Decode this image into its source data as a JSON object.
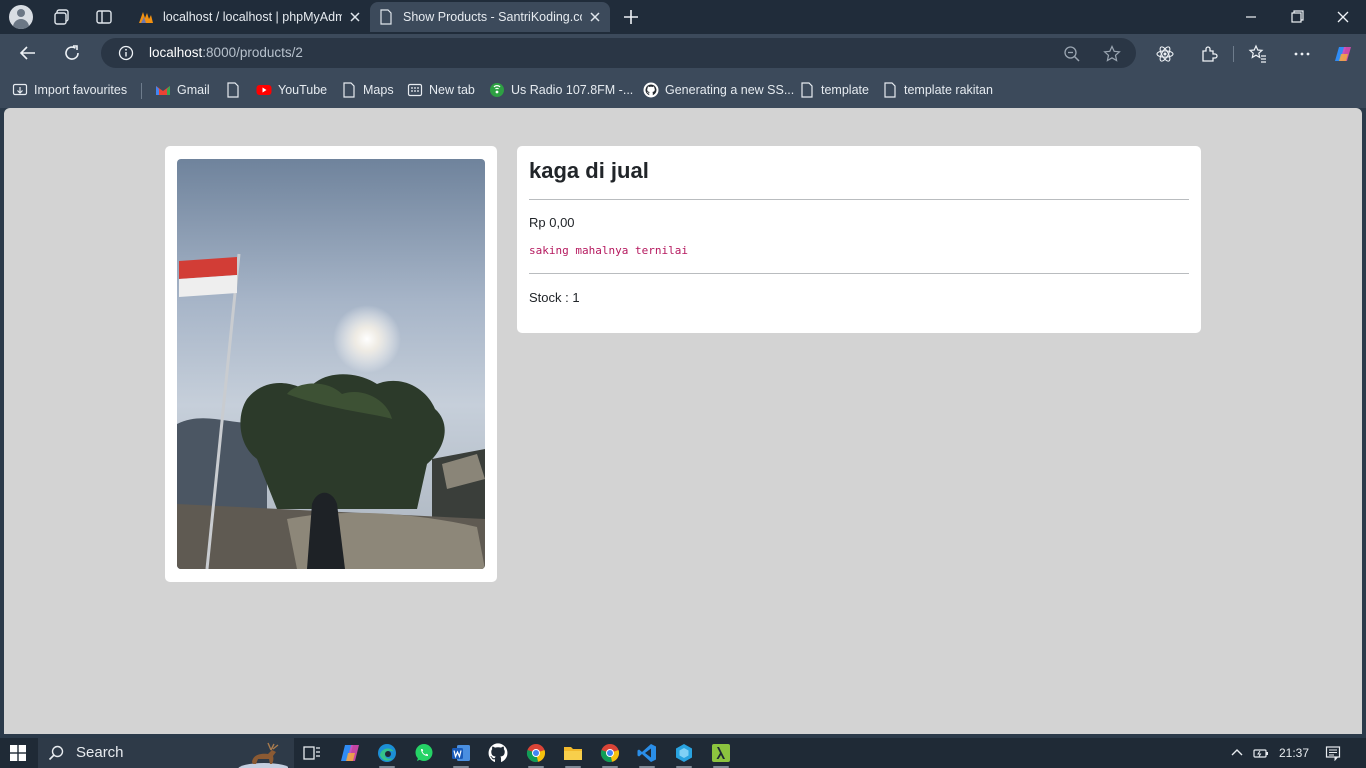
{
  "browser": {
    "tabs": [
      {
        "title": "localhost / localhost | phpMyAdmin",
        "icon": "phpmyadmin-icon",
        "active": false
      },
      {
        "title": "Show Products - SantriKoding.com",
        "icon": "page-icon",
        "active": true
      }
    ],
    "url": {
      "host": "localhost",
      "path": ":8000/products/2"
    },
    "bookmarks": [
      {
        "label": "Import favourites",
        "icon": "import-icon"
      },
      {
        "label": "Gmail",
        "icon": "gmail-icon"
      },
      {
        "label": "",
        "icon": "page-icon"
      },
      {
        "label": "YouTube",
        "icon": "youtube-icon"
      },
      {
        "label": "Maps",
        "icon": "page-icon"
      },
      {
        "label": "New tab",
        "icon": "newtab-icon"
      },
      {
        "label": "Us Radio 107.8FM -...",
        "icon": "radio-icon"
      },
      {
        "label": "Generating a new SS...",
        "icon": "github-icon"
      },
      {
        "label": "template",
        "icon": "page-icon"
      },
      {
        "label": "template rakitan",
        "icon": "page-icon"
      }
    ]
  },
  "product": {
    "title": "kaga di jual",
    "price": "Rp 0,00",
    "description": "saking mahalnya ternilai",
    "stock_label": "Stock : ",
    "stock_value": "1"
  },
  "taskbar": {
    "search_label": "Search",
    "clock": "21:37",
    "apps": [
      "task-view-icon",
      "copilot-icon",
      "edge-icon",
      "whatsapp-icon",
      "word-icon",
      "github-icon",
      "chrome-icon",
      "file-explorer-icon",
      "chrome-icon",
      "vscode-icon",
      "app-icon",
      "lambda-icon"
    ]
  },
  "colors": {
    "chrome_dark": "#202c3a",
    "chrome": "#3c4a5b",
    "page_bg": "#d3d3d3",
    "desc_pink": "#b5185e"
  }
}
